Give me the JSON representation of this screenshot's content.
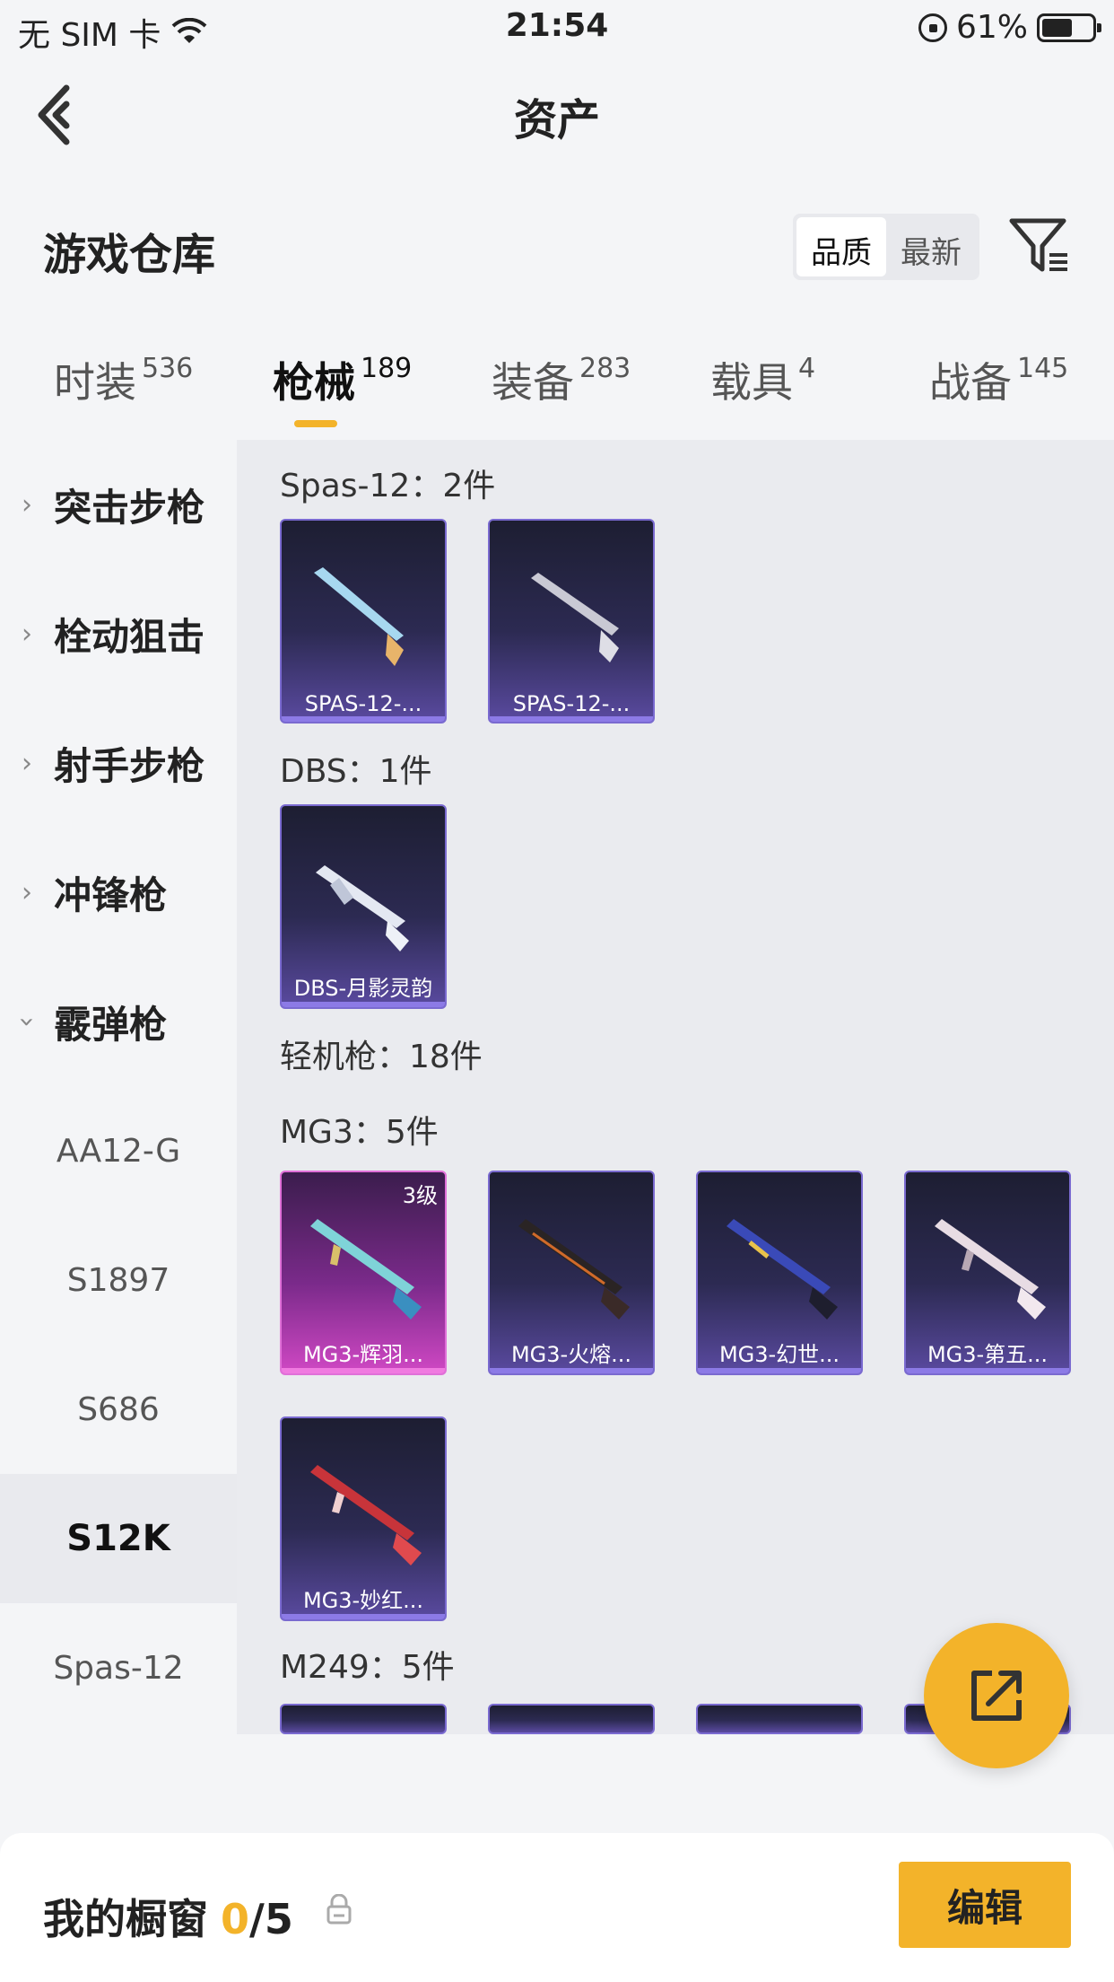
{
  "status_bar": {
    "carrier": "无 SIM 卡",
    "time": "21:54",
    "battery": "61%"
  },
  "nav": {
    "title": "资产"
  },
  "warehouse": {
    "title": "游戏仓库",
    "sort_options": [
      "品质",
      "最新"
    ],
    "active_sort": "品质"
  },
  "tabs": [
    {
      "label": "时装",
      "count": "536"
    },
    {
      "label": "枪械",
      "count": "189"
    },
    {
      "label": "装备",
      "count": "283"
    },
    {
      "label": "载具",
      "count": "4"
    },
    {
      "label": "战备",
      "count": "145"
    }
  ],
  "sidebar": {
    "categories": [
      "突击步枪",
      "栓动狙击",
      "射手步枪",
      "冲锋枪",
      "霰弹枪"
    ],
    "subitems": [
      "AA12-G",
      "S1897",
      "S686",
      "S12K",
      "Spas-12"
    ],
    "active_sub": "S12K"
  },
  "content": {
    "groups": [
      {
        "label": "Spas-12：2件",
        "cards": [
          "SPAS-12-...",
          "SPAS-12-..."
        ]
      },
      {
        "label": "DBS：1件",
        "cards": [
          "DBS-月影灵韵"
        ]
      },
      {
        "label": "轻机枪：18件"
      },
      {
        "label": "MG3：5件",
        "cards": [
          "MG3-辉羽...",
          "MG3-火熔...",
          "MG3-幻世...",
          "MG3-第五...",
          "MG3-妙红..."
        ],
        "level_badge": "3级"
      },
      {
        "label": "M249：5件"
      }
    ]
  },
  "bottom": {
    "showcase_label": "我的橱窗",
    "showcase_current": "0",
    "showcase_total": "/5",
    "edit_label": "编辑"
  },
  "colors": {
    "accent": "#f3b32a",
    "card_purple": "#2c2a52",
    "card_pink": "#7a2a8a"
  }
}
